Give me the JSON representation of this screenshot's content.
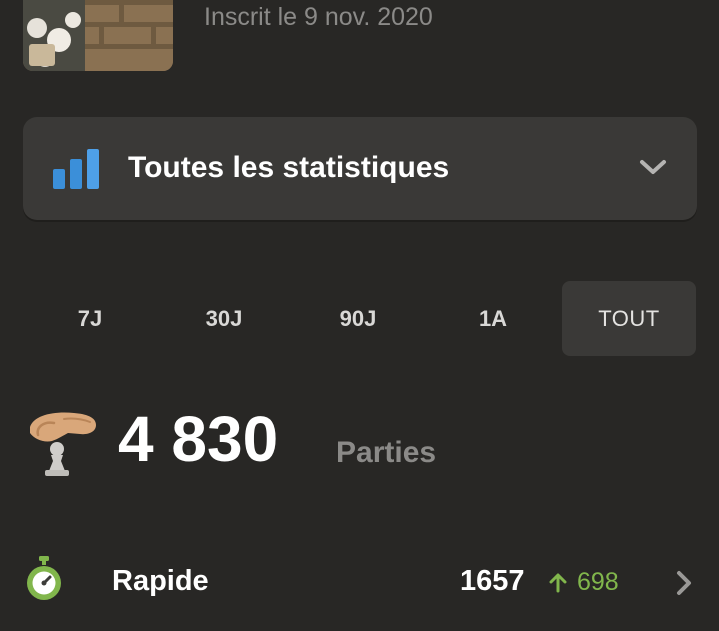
{
  "profile": {
    "joined_text": "Inscrit le 9 nov. 2020"
  },
  "stats_dropdown": {
    "icon": "bar-chart-icon",
    "label": "Toutes les statistiques",
    "chevron_icon": "chevron-down-icon"
  },
  "range_tabs": [
    {
      "label": "7J",
      "active": false
    },
    {
      "label": "30J",
      "active": false
    },
    {
      "label": "90J",
      "active": false
    },
    {
      "label": "1A",
      "active": false
    },
    {
      "label": "TOUT",
      "active": true
    }
  ],
  "games": {
    "icon": "pawn-in-hand-icon",
    "count": "4 830",
    "label": "Parties"
  },
  "modes": [
    {
      "icon": "stopwatch-icon",
      "label": "Rapide",
      "rating": "1657",
      "change_icon": "arrow-up-icon",
      "change": "698",
      "chevron_icon": "chevron-right-icon"
    }
  ],
  "colors": {
    "background": "#282725",
    "card": "#3a3937",
    "positive": "#81b64c",
    "muted_text": "#8b8a88",
    "accent_blue": "#3b8fd9"
  }
}
